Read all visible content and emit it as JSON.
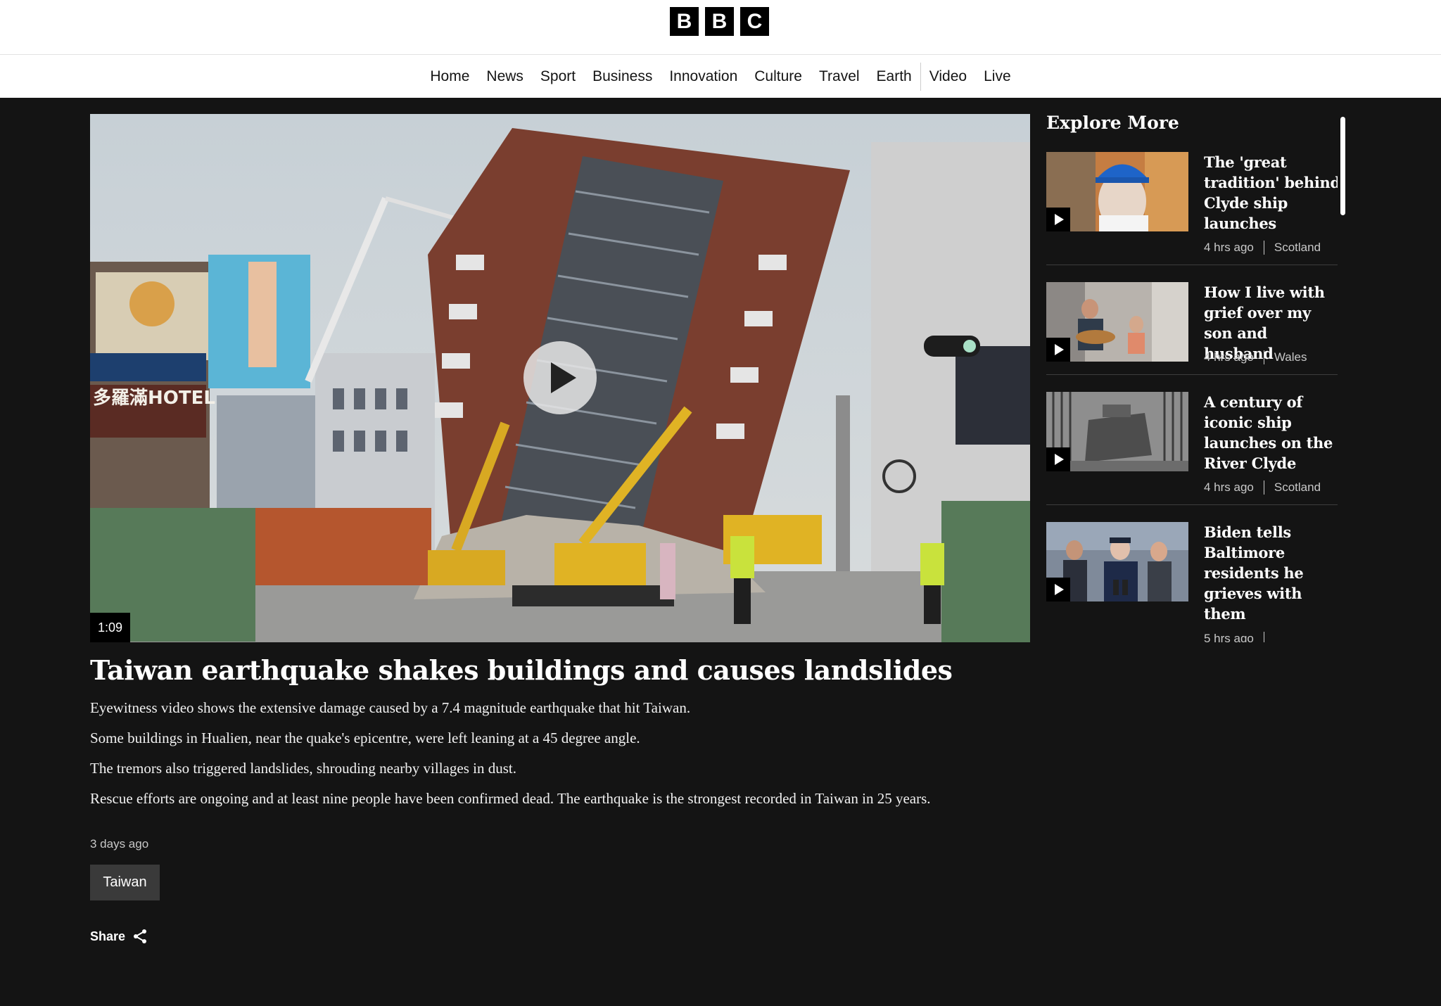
{
  "brand": {
    "letters": [
      "B",
      "B",
      "C"
    ]
  },
  "nav": {
    "items": [
      "Home",
      "News",
      "Sport",
      "Business",
      "Innovation",
      "Culture",
      "Travel",
      "Earth",
      "Video",
      "Live"
    ]
  },
  "video": {
    "duration": "1:09",
    "sign_text": "多羅滿HOTEL"
  },
  "article": {
    "headline": "Taiwan earthquake shakes buildings and causes landslides",
    "paragraphs": [
      "Eyewitness video shows the extensive damage caused by a 7.4 magnitude earthquake that hit Taiwan.",
      "Some buildings in Hualien, near the quake's epicentre, were left leaning at a 45 degree angle.",
      "The tremors also triggered landslides, shrouding nearby villages in dust.",
      "Rescue efforts are ongoing and at least nine people have been confirmed dead. The earthquake is the strongest recorded in Taiwan in 25 years."
    ],
    "timestamp": "3 days ago",
    "tag": "Taiwan",
    "share_label": "Share"
  },
  "sidebar": {
    "title": "Explore More",
    "items": [
      {
        "title": "The 'great tradition' behind Clyde ship launches",
        "time": "4 hrs ago",
        "section": "Scotland"
      },
      {
        "title": "How I live with grief over my son and husband",
        "time": "4 hrs ago",
        "section": "Wales"
      },
      {
        "title": "A century of iconic ship launches on the River Clyde",
        "time": "4 hrs ago",
        "section": "Scotland"
      },
      {
        "title": "Biden tells Baltimore residents he grieves with them",
        "time": "5 hrs ago",
        "section": ""
      }
    ]
  },
  "colors": {
    "page_bg": "#141414",
    "header_bg": "#ffffff",
    "tag_bg": "#3a3a3a",
    "text_primary": "#ffffff",
    "text_muted": "#c8c8c8"
  }
}
